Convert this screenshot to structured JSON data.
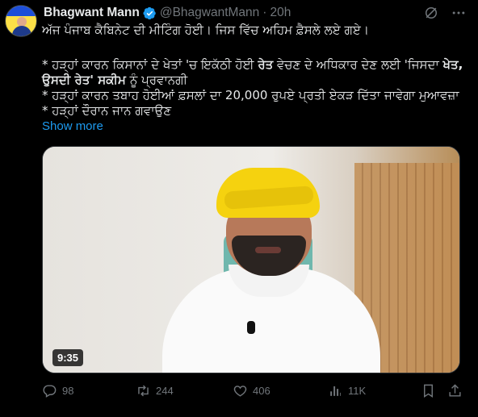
{
  "author": {
    "name": "Bhagwant Mann",
    "handle": "@BhagwantMann",
    "separator": "·",
    "time": "20h",
    "avatar_icon": "avatar-icon",
    "verified_icon": "verified-badge-icon"
  },
  "tweet": {
    "line1": "ਅੱਜ ਪੰਜਾਬ ਕੈਬਿਨੇਟ ਦੀ ਮੀਟਿੰਗ ਹੋਈ। ਜਿਸ ਵਿੱਚ ਅਹਿਮ ਫ਼ੈਸਲੇ ਲਏ ਗਏ।",
    "bullet1a": "* ਹੜ੍ਹਾਂ ਕਾਰਨ ਕਿਸਾਨਾਂ ਦੇ ਖੇਤਾਂ 'ਚ ਇਕੱਠੀ ਹੋਈ ",
    "bullet1_bold1": "ਰੇਤ",
    "bullet1b": " ਵੇਚਣ ਦੇ ਅਧਿਕਾਰ ਦੇਣ ਲਈ 'ਜਿਸਦਾ ",
    "bullet1_bold2": "ਖੇਤ,",
    "bullet1_bold3": "ਉਸਦੀ ਰੇਤ' ਸਕੀਮ",
    "bullet1c": " ਨੂੰ ਪ੍ਰਵਾਨਗੀ",
    "bullet2": "* ਹੜ੍ਹਾਂ ਕਾਰਨ ਤਬਾਹ ਹੋਈਆਂ ਫ਼ਸਲਾਂ ਦਾ 20,000 ਰੁਪਏ ਪ੍ਰਤੀ ਏਕੜ ਦਿੱਤਾ ਜਾਵੇਗਾ ਮੁਆਵਜ਼ਾ",
    "bullet3": "* ਹੜ੍ਹਾਂ ਦੌਰਾਨ ਜਾਨ ਗਵਾਉਣ",
    "show_more": "Show more"
  },
  "media": {
    "duration": "9:35"
  },
  "actions": {
    "replies": "98",
    "retweets": "244",
    "likes": "406",
    "views": "11K"
  },
  "colors": {
    "accent": "#1d9bf0",
    "muted": "#71767b",
    "text": "#e7e9ea",
    "background": "#000000"
  }
}
